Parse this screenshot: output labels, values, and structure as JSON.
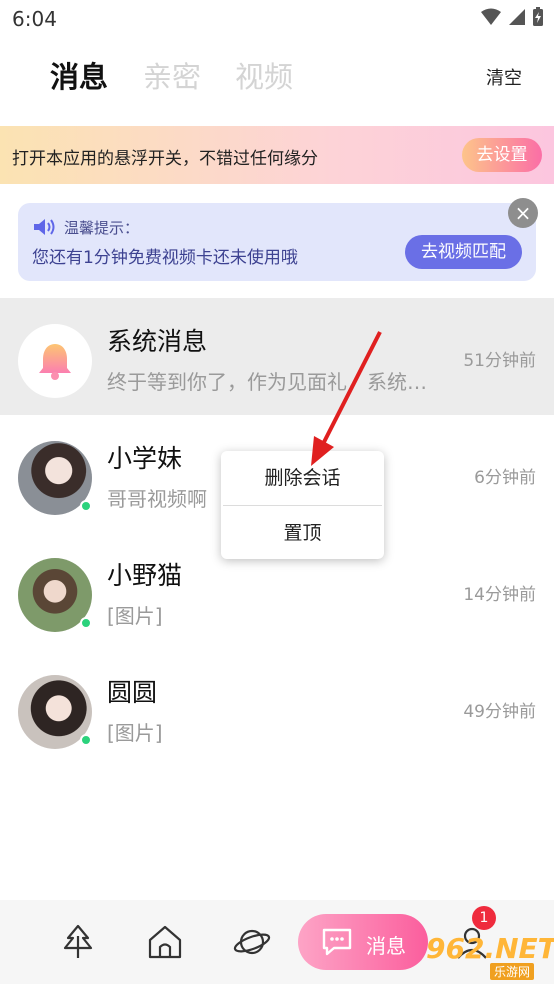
{
  "status_bar": {
    "time": "6:04"
  },
  "header": {
    "tabs": [
      {
        "label": "消息",
        "active": true
      },
      {
        "label": "亲密",
        "active": false
      },
      {
        "label": "视频",
        "active": false
      }
    ],
    "clear_label": "清空"
  },
  "float_banner": {
    "text": "打开本应用的悬浮开关，不错过任何缘分",
    "button": "去设置"
  },
  "tip": {
    "title": "温馨提示：",
    "text": "您还有1分钟免费视频卡还未使用哦",
    "button": "去视频匹配",
    "close": "×"
  },
  "conversations": [
    {
      "name": "系统消息",
      "message": "终于等到你了，作为见面礼，系统…",
      "time": "51分钟前",
      "type": "system"
    },
    {
      "name": "小学妹",
      "message": "哥哥视频啊",
      "time": "6分钟前",
      "online": true
    },
    {
      "name": "小野猫",
      "message": "[图片]",
      "time": "14分钟前",
      "online": true
    },
    {
      "name": "圆圆",
      "message": "[图片]",
      "time": "49分钟前",
      "online": true
    }
  ],
  "context_menu": {
    "items": [
      "删除会话",
      "置顶"
    ]
  },
  "bottom_nav": {
    "items": [
      "tree-icon",
      "home-icon",
      "planet-icon",
      "message-icon",
      "profile-icon"
    ],
    "active_label": "消息",
    "badge": "1"
  },
  "watermark": {
    "text": "962.NET",
    "sub": "乐游网"
  },
  "colors": {
    "accent_pink": "#fb5e9d",
    "tip_button": "#6a6fe6",
    "online": "#2bd27c",
    "badge": "#ef2b3d"
  }
}
